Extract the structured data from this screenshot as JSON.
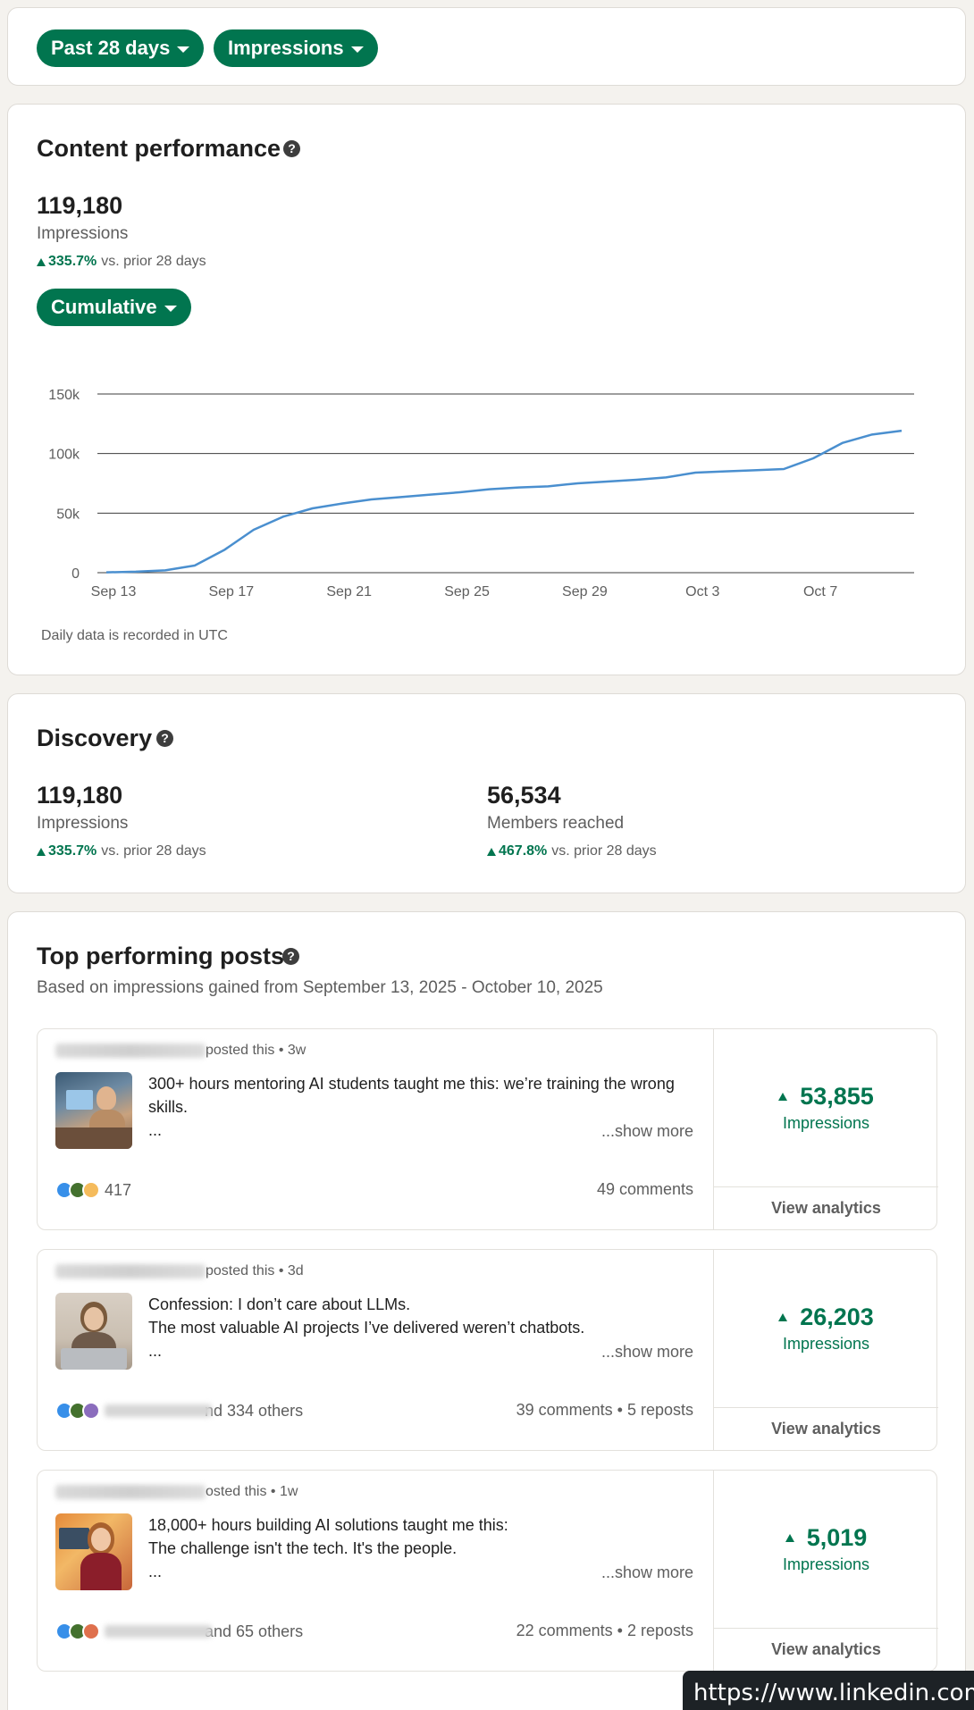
{
  "filters": {
    "range_label": "Past 28 days",
    "metric_label": "Impressions"
  },
  "content_performance": {
    "title": "Content performance",
    "help_glyph": "?",
    "value": "119,180",
    "label": "Impressions",
    "delta_pct": "335.7%",
    "delta_text": "vs. prior 28 days",
    "mode_label": "Cumulative",
    "footnote": "Daily data is recorded in UTC"
  },
  "chart_data": {
    "type": "line",
    "x": [
      "Sep 13",
      "Sep 14",
      "Sep 15",
      "Sep 16",
      "Sep 17",
      "Sep 18",
      "Sep 19",
      "Sep 20",
      "Sep 21",
      "Sep 22",
      "Sep 23",
      "Sep 24",
      "Sep 25",
      "Sep 26",
      "Sep 27",
      "Sep 28",
      "Sep 29",
      "Sep 30",
      "Oct 1",
      "Oct 2",
      "Oct 3",
      "Oct 4",
      "Oct 5",
      "Oct 6",
      "Oct 7",
      "Oct 8",
      "Oct 9",
      "Oct 10"
    ],
    "series": [
      {
        "values": [
          300,
          800,
          2000,
          6000,
          19000,
          36000,
          47000,
          54000,
          58000,
          61500,
          63500,
          65500,
          67500,
          70000,
          71500,
          72500,
          75000,
          76500,
          78000,
          80000,
          84000,
          85000,
          86000,
          87000,
          96000,
          109000,
          116000,
          119180
        ],
        "color": "#4a8fcf"
      }
    ],
    "x_tick_labels": [
      "Sep 13",
      "Sep 17",
      "Sep 21",
      "Sep 25",
      "Sep 29",
      "Oct 3",
      "Oct 7"
    ],
    "y_ticks": [
      0,
      50000,
      100000,
      150000
    ],
    "y_tick_labels": [
      "0",
      "50k",
      "100k",
      "150k"
    ],
    "ylim": [
      0,
      150000
    ],
    "grid": true
  },
  "discovery": {
    "title": "Discovery",
    "help_glyph": "?",
    "impressions": {
      "value": "119,180",
      "label": "Impressions",
      "delta_pct": "335.7%",
      "delta_text": "vs. prior 28 days"
    },
    "members": {
      "value": "56,534",
      "label": "Members reached",
      "delta_pct": "467.8%",
      "delta_text": "vs. prior 28 days"
    }
  },
  "top_posts": {
    "title": "Top performing posts",
    "help_glyph": "?",
    "subtitle": "Based on impressions gained from September 13, 2025 - October 10, 2025",
    "items": [
      {
        "posted": "posted this • 3w",
        "line1": "300+ hours mentoring AI students taught me this: we’re training the wrong skills.",
        "line2": "...",
        "show_more": "...show more",
        "reactions": "417",
        "comments": "49 comments",
        "impressions": "53,855",
        "impressions_label": "Impressions",
        "cta": "View analytics"
      },
      {
        "posted": "posted this • 3d",
        "line1": "Confession: I don’t care about LLMs.",
        "line2": "The most valuable AI projects I’ve delivered weren’t chatbots.",
        "line3": "...",
        "show_more": "...show more",
        "reactions": "nd 334 others",
        "comments": "39 comments • 5 reposts",
        "impressions": "26,203",
        "impressions_label": "Impressions",
        "cta": "View analytics"
      },
      {
        "posted": "osted this • 1w",
        "line1": "18,000+ hours building AI solutions taught me this:",
        "line2": "The challenge isn't the tech. It's the people.",
        "line3": "...",
        "show_more": "...show more",
        "reactions": "and 65 others",
        "comments": "22 comments • 2 reposts",
        "impressions": "5,019",
        "impressions_label": "Impressions",
        "cta": "View analytics"
      }
    ]
  },
  "status_url": "https://www.linkedin.com/ar",
  "colors": {
    "accent_green": "#01754f",
    "chart_line": "#4a8fcf",
    "page_bg": "#f4f2ee"
  }
}
